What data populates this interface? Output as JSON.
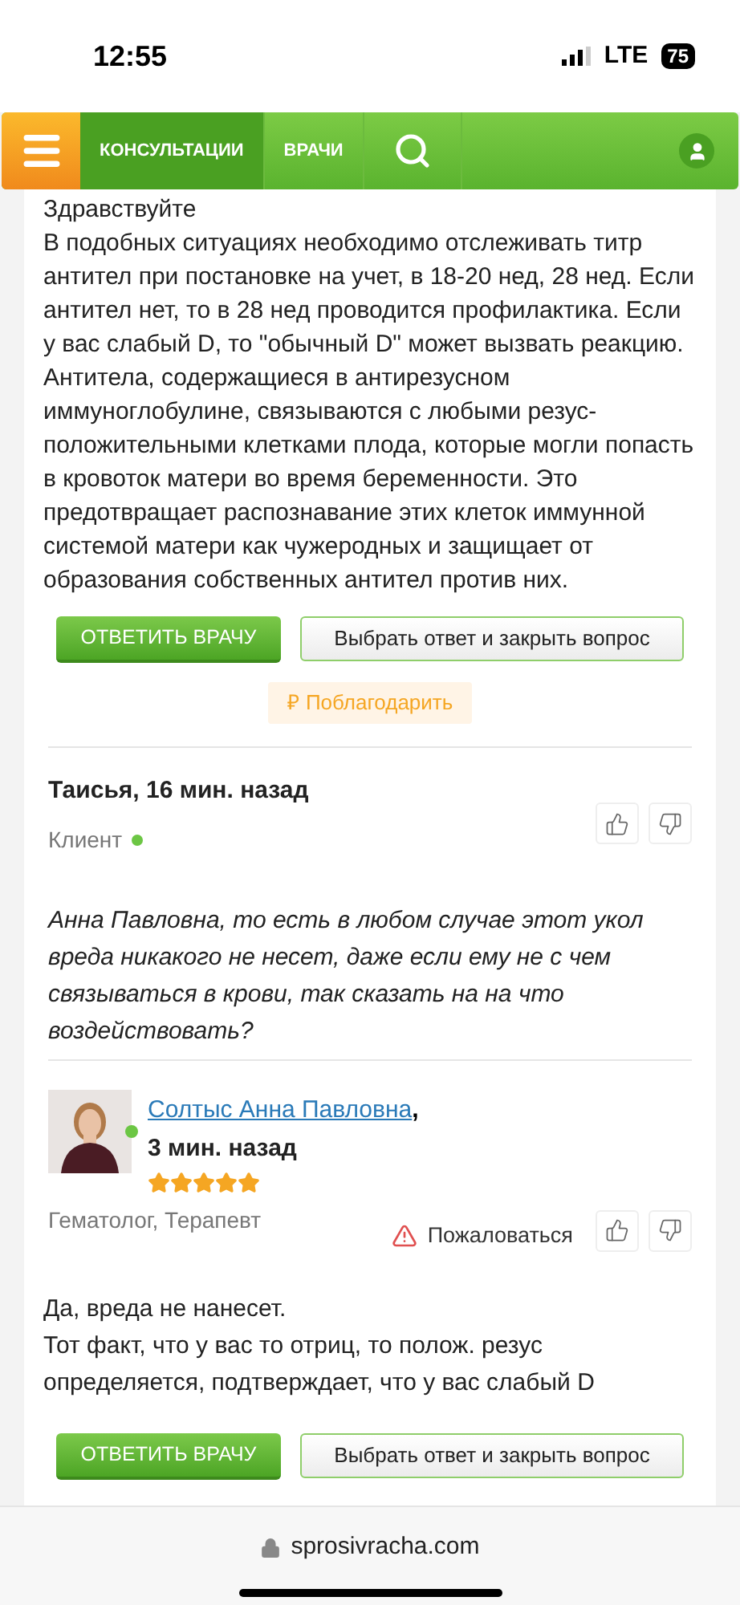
{
  "status_bar": {
    "time": "12:55",
    "network": "LTE",
    "battery": "75"
  },
  "nav": {
    "tabs": [
      {
        "label": "КОНСУЛЬТАЦИИ",
        "selected": true
      },
      {
        "label": "ВРАЧИ",
        "selected": false
      }
    ]
  },
  "answer": {
    "paragraphs": [
      "Здравствуйте",
      "В подобных ситуациях необходимо отслеживать титр антител при постановке на учет, в 18-20 нед, 28 нед. Если антител нет, то в 28 нед проводится профилактика. Если у вас слабый D, то \"обычный D\" может вызвать реакцию. Антитела, содержащиеся в антирезусном иммуноглобулине, связываются с любыми резус-положительными клетками плода, которые могли попасть в кровоток матери во время беременности. Это предотвращает распознавание этих клеток иммунной системой матери как чужеродных и защищает от образования собственных антител против них."
    ],
    "reply_button": "ОТВЕТИТЬ ВРАЧУ",
    "close_button": "Выбрать ответ и закрыть вопрос",
    "thank_button": "₽ Поблагодарить"
  },
  "comment": {
    "author": "Таисья, 16 мин. назад",
    "role": "Клиент",
    "online": true,
    "text": "Анна Павловна, то есть в любом случае этот укол вреда никакого не несет, даже если ему не с чем связываться в крови, так сказать на на что воздействовать?"
  },
  "doctor_answer": {
    "name": "Солтыс Анна Павловна",
    "comma": ",",
    "time": "3 мин. назад",
    "online": true,
    "stars": 5,
    "specialty": "Гематолог, Терапевт",
    "complaint": "Пожаловаться",
    "paragraphs": [
      "Да, вреда не нанесет.",
      "Тот факт, что у вас то отриц, то полож. резус определяется, подтверждает, что у вас слабый D"
    ],
    "reply_button": "ОТВЕТИТЬ ВРАЧУ",
    "close_button": "Выбрать ответ и закрыть вопрос"
  },
  "url_bar": {
    "url": "sprosivracha.com"
  }
}
